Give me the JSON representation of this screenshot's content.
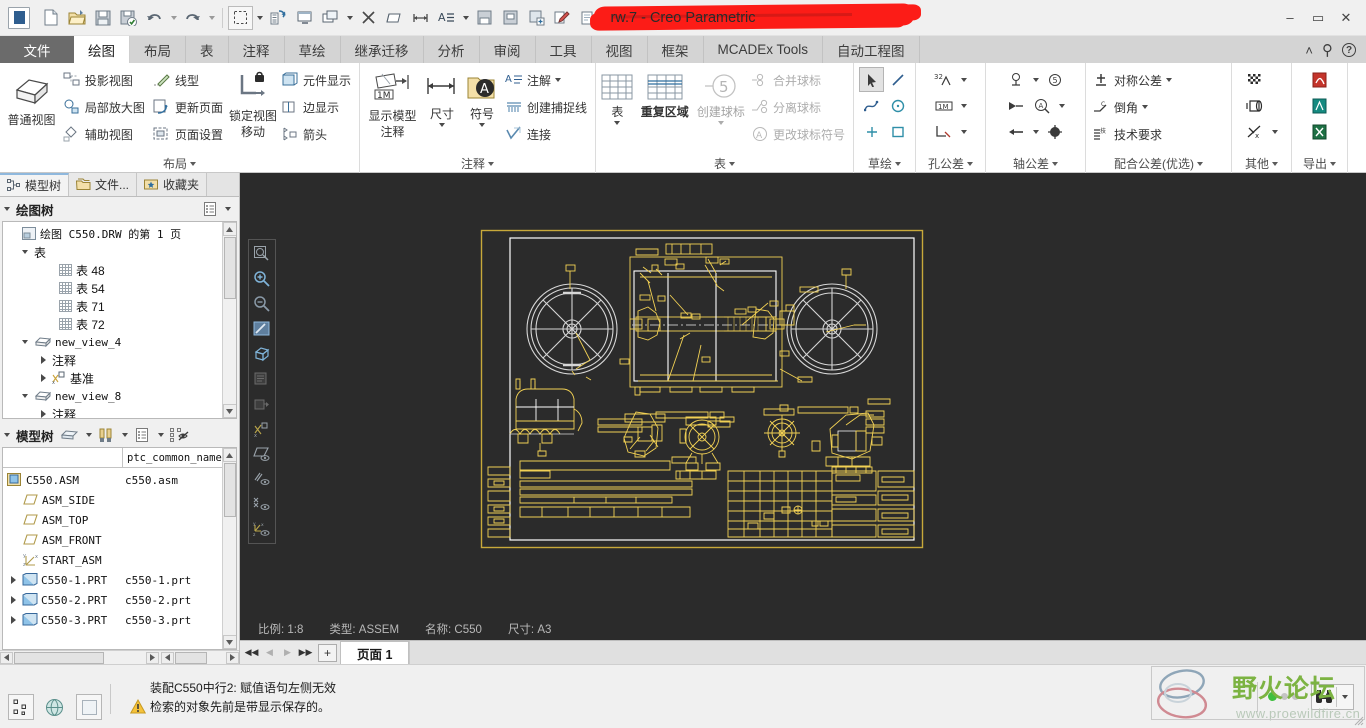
{
  "window": {
    "title": "rw.7 - Creo Parametric",
    "redacted": true,
    "minimize": "–",
    "maximize": "▭",
    "close": "✕"
  },
  "quick_access": [
    {
      "name": "new-file-icon",
      "label": "新建"
    },
    {
      "name": "open-file-icon",
      "label": "打开"
    },
    {
      "name": "save-icon",
      "label": "保存"
    },
    {
      "name": "save-as-icon",
      "label": "另存为"
    },
    {
      "name": "undo-icon",
      "label": "撤消"
    },
    {
      "name": "redo-icon",
      "label": "重做"
    },
    {
      "name": "select-region-icon",
      "label": "选择"
    },
    {
      "name": "regenerate-icon",
      "label": "重新生成"
    },
    {
      "name": "display-style-icon",
      "label": "显示样式"
    },
    {
      "name": "window-icon",
      "label": "窗口"
    },
    {
      "name": "close-window-icon",
      "label": "关闭"
    },
    {
      "name": "erase-icon",
      "label": "拭除"
    },
    {
      "name": "dimension-icon",
      "label": "尺寸"
    },
    {
      "name": "text-style-icon",
      "label": "文本样式"
    },
    {
      "name": "save-sheet-icon",
      "label": "保存页面"
    },
    {
      "name": "sheet-setup-icon",
      "label": "页面设置"
    },
    {
      "name": "sheet-add-icon",
      "label": "添加页面"
    },
    {
      "name": "annotate-icon",
      "label": "注释"
    },
    {
      "name": "export-icon",
      "label": "导出"
    }
  ],
  "ribbon_tabs": [
    {
      "label": "文件",
      "active": false,
      "is_file": true
    },
    {
      "label": "绘图",
      "active": true
    },
    {
      "label": "布局",
      "active": false
    },
    {
      "label": "表",
      "active": false
    },
    {
      "label": "注释",
      "active": false
    },
    {
      "label": "草绘",
      "active": false
    },
    {
      "label": "继承迁移",
      "active": false
    },
    {
      "label": "分析",
      "active": false
    },
    {
      "label": "审阅",
      "active": false
    },
    {
      "label": "工具",
      "active": false
    },
    {
      "label": "视图",
      "active": false
    },
    {
      "label": "框架",
      "active": false
    },
    {
      "label": "MCADEx Tools",
      "active": false
    },
    {
      "label": "自动工程图",
      "active": false
    }
  ],
  "tab_right_icons": [
    {
      "name": "collapse-ribbon-icon",
      "glyph": "˄"
    },
    {
      "name": "search-icon",
      "glyph": "⚲"
    },
    {
      "name": "help-icon",
      "glyph": "?"
    }
  ],
  "ribbon_groups": [
    {
      "title": "布局",
      "big_button": {
        "label": "普通视图",
        "icon": "general-view-icon"
      },
      "columns": [
        {
          "items": [
            {
              "label": "投影视图",
              "icon": "projection-view-icon",
              "disabled": false
            },
            {
              "label": "局部放大图",
              "icon": "detailed-view-icon",
              "disabled": false
            },
            {
              "label": "辅助视图",
              "icon": "auxiliary-view-icon",
              "disabled": false
            }
          ]
        },
        {
          "items": [
            {
              "label": "线型",
              "icon": "line-style-icon",
              "disabled": false
            },
            {
              "label": "更新页面",
              "icon": "update-sheet-icon",
              "disabled": false
            },
            {
              "label": "页面设置",
              "icon": "sheet-setup-icon",
              "disabled": false
            }
          ]
        }
      ],
      "stack_button": {
        "label1": "锁定视图",
        "label2": "移动",
        "icon": "lock-view-movement-icon"
      },
      "columns2": [
        {
          "items": [
            {
              "label": "元件显示",
              "icon": "component-display-icon",
              "disabled": false
            },
            {
              "label": "边显示",
              "icon": "edge-display-icon",
              "disabled": false
            },
            {
              "label": "箭头",
              "icon": "arrows-icon",
              "disabled": false
            }
          ]
        }
      ]
    },
    {
      "title": "注释",
      "big_buttons": [
        {
          "label1": "显示模型",
          "label2": "注释",
          "icon": "show-model-annotations-icon",
          "caret": false
        },
        {
          "label1": "尺寸",
          "label2": "",
          "icon": "dimension-icon",
          "caret": true
        },
        {
          "label1": "符号",
          "label2": "",
          "icon": "symbol-icon",
          "caret": true
        }
      ],
      "columns": [
        {
          "items": [
            {
              "label": "注解",
              "icon": "note-icon",
              "caret": true
            },
            {
              "label": "创建捕捉线",
              "icon": "snap-line-icon"
            },
            {
              "label": "连接",
              "icon": "connect-icon"
            }
          ]
        }
      ]
    },
    {
      "title": "表",
      "big_buttons": [
        {
          "label1": "表",
          "label2": "",
          "icon": "table-icon",
          "caret": true
        },
        {
          "label1": "重复区域",
          "label2": "",
          "icon": "repeat-region-icon",
          "caret": false
        },
        {
          "label1": "创建球标",
          "label2": "",
          "icon": "create-balloons-icon",
          "caret": true,
          "disabled": true
        }
      ],
      "columns": [
        {
          "items": [
            {
              "label": "合并球标",
              "icon": "merge-balloons-icon",
              "disabled": true
            },
            {
              "label": "分离球标",
              "icon": "split-balloons-icon",
              "disabled": true
            },
            {
              "label": "更改球标符号",
              "icon": "change-balloon-symbol-icon",
              "disabled": true
            }
          ]
        }
      ]
    },
    {
      "title": "草绘",
      "icon_grid": [
        [
          {
            "name": "select-arrow-icon",
            "selected": true
          },
          {
            "name": "line-icon"
          }
        ],
        [
          {
            "name": "spline-icon"
          },
          {
            "name": "circle-icon"
          }
        ],
        [
          {
            "name": "point-icon"
          },
          {
            "name": "rectangle-icon"
          }
        ]
      ]
    },
    {
      "title": "孔公差",
      "icon_grid": [
        [
          {
            "name": "surface-finish-32-icon",
            "caret": true
          }
        ],
        [
          {
            "name": "datum-1m-icon",
            "caret": true
          }
        ],
        [
          {
            "name": "hole-tolerance-icon",
            "caret": true
          }
        ]
      ]
    },
    {
      "title": "轴公差",
      "icon_grid": [
        [
          {
            "name": "datum-feature-icon",
            "caret": true
          },
          {
            "name": "balloon-5-icon"
          }
        ],
        [
          {
            "name": "arrow-leader-icon"
          },
          {
            "name": "magnify-balloon-icon",
            "caret": true
          }
        ],
        [
          {
            "name": "left-arrow-icon",
            "caret": true
          },
          {
            "name": "center-mark-icon"
          }
        ]
      ]
    },
    {
      "title": "配合公差(优选)",
      "columns": [
        {
          "items": [
            {
              "label": "对称公差",
              "icon": "symmetric-tolerance-icon",
              "caret": true
            },
            {
              "label": "倒角",
              "icon": "chamfer-icon",
              "caret": true
            },
            {
              "label": "技术要求",
              "icon": "technical-requirements-icon"
            }
          ]
        }
      ]
    },
    {
      "title": "其他",
      "icon_grid": [
        [
          {
            "name": "hatch-pattern-icon"
          }
        ],
        [
          {
            "name": "cylinder-icon"
          }
        ],
        [
          {
            "name": "cross-lines-icon",
            "caret": true
          }
        ]
      ]
    },
    {
      "title": "导出",
      "icon_grid": [
        [
          {
            "name": "export-pdf-icon"
          }
        ],
        [
          {
            "name": "export-dwg-icon"
          }
        ],
        [
          {
            "name": "export-excel-icon"
          }
        ]
      ]
    }
  ],
  "left_panel": {
    "nav_tabs": [
      {
        "label": "模型树",
        "icon": "model-tree-icon",
        "active": true
      },
      {
        "label": "文件...",
        "icon": "folder-browser-icon",
        "active": false
      },
      {
        "label": "收藏夹",
        "icon": "favorites-icon",
        "active": false
      }
    ],
    "drawing_tree": {
      "title": "绘图树",
      "settings_icon": "tree-settings-icon",
      "nodes": [
        {
          "indent": 0,
          "twisty": "",
          "icon": "sheet-icon",
          "label": "绘图 C550.DRW 的第 1 页",
          "mono": true
        },
        {
          "indent": 1,
          "twisty": "down",
          "icon": "",
          "label": "表",
          "mono": false
        },
        {
          "indent": 3,
          "twisty": "",
          "icon": "table-icon",
          "label": "表 48",
          "mono": false
        },
        {
          "indent": 3,
          "twisty": "",
          "icon": "table-icon",
          "label": "表 54",
          "mono": false
        },
        {
          "indent": 3,
          "twisty": "",
          "icon": "table-icon",
          "label": "表 71",
          "mono": false
        },
        {
          "indent": 3,
          "twisty": "",
          "icon": "table-icon",
          "label": "表 72",
          "mono": false
        },
        {
          "indent": 1,
          "twisty": "down",
          "icon": "view-icon",
          "label": "new_view_4",
          "mono": true
        },
        {
          "indent": 2,
          "twisty": "right",
          "icon": "",
          "label": "注释",
          "mono": false
        },
        {
          "indent": 2,
          "twisty": "right",
          "icon": "datum-icon",
          "label": "基准",
          "mono": false
        },
        {
          "indent": 1,
          "twisty": "down",
          "icon": "view-icon",
          "label": "new_view_8",
          "mono": true
        },
        {
          "indent": 2,
          "twisty": "right",
          "icon": "",
          "label": "注释",
          "mono": false
        }
      ]
    },
    "model_tree": {
      "title": "模型树",
      "toolbar_icons": [
        {
          "name": "model-filter-icon",
          "caret": true
        },
        {
          "name": "settings-tools-icon",
          "caret": true
        },
        {
          "name": "tree-columns-icon",
          "caret": true
        },
        {
          "name": "tree-display-icon",
          "caret": false
        }
      ],
      "columns": [
        "",
        "ptc_common_name"
      ],
      "rows": [
        {
          "indent": 0,
          "twisty": "",
          "icon": "assembly-icon",
          "name": "C550.ASM",
          "common_name": "c550.asm"
        },
        {
          "indent": 1,
          "twisty": "",
          "icon": "plane-icon",
          "name": "ASM_SIDE",
          "common_name": ""
        },
        {
          "indent": 1,
          "twisty": "",
          "icon": "plane-icon",
          "name": "ASM_TOP",
          "common_name": ""
        },
        {
          "indent": 1,
          "twisty": "",
          "icon": "plane-icon",
          "name": "ASM_FRONT",
          "common_name": ""
        },
        {
          "indent": 1,
          "twisty": "",
          "icon": "csys-icon",
          "name": "START_ASM",
          "common_name": ""
        },
        {
          "indent": 0,
          "twisty": "right",
          "icon": "part-icon",
          "name": "C550-1.PRT",
          "common_name": "c550-1.prt"
        },
        {
          "indent": 0,
          "twisty": "right",
          "icon": "part-icon",
          "name": "C550-2.PRT",
          "common_name": "c550-2.prt"
        },
        {
          "indent": 0,
          "twisty": "right",
          "icon": "part-icon",
          "name": "C550-3.PRT",
          "common_name": "c550-3.prt"
        }
      ]
    }
  },
  "canvas": {
    "background_color": "#2b2b2b",
    "sheet_border_color": "#c8a93a",
    "geometry_color": "#f2d154",
    "wheel_color": "#d6d6d6",
    "view_tools": [
      {
        "name": "refit-icon"
      },
      {
        "name": "zoom-in-icon"
      },
      {
        "name": "zoom-out-icon"
      },
      {
        "name": "repaint-icon"
      },
      {
        "name": "display-style-icon"
      },
      {
        "name": "saved-views-icon"
      },
      {
        "name": "view-manager-icon"
      },
      {
        "name": "datum-display-icon"
      },
      {
        "name": "plane-display-icon"
      },
      {
        "name": "axis-display-icon"
      },
      {
        "name": "point-display-icon"
      },
      {
        "name": "csys-display-icon"
      }
    ]
  },
  "status_line": {
    "items": [
      {
        "key": "比例",
        "value": "1:8",
        "text": "比例: 1:8"
      },
      {
        "key": "类型",
        "value": "ASSEM",
        "text": "类型: ASSEM"
      },
      {
        "key": "名称",
        "value": "C550",
        "text": "名称: C550"
      },
      {
        "key": "尺寸",
        "value": "A3",
        "text": "尺寸: A3"
      }
    ]
  },
  "page_tabs": {
    "nav": [
      {
        "name": "first-page-button",
        "glyph": "◀◀",
        "disabled": false
      },
      {
        "name": "prev-page-button",
        "glyph": "◀",
        "disabled": true
      },
      {
        "name": "next-page-button",
        "glyph": "▶",
        "disabled": true
      },
      {
        "name": "last-page-button",
        "glyph": "▶▶",
        "disabled": false
      }
    ],
    "add_label": "+",
    "tabs": [
      {
        "label": "页面 1",
        "active": true
      }
    ]
  },
  "bottom": {
    "icons": [
      {
        "name": "selection-filter-icon"
      },
      {
        "name": "web-browser-icon"
      },
      {
        "name": "blank-panel-icon"
      }
    ],
    "messages": [
      {
        "icon": "",
        "text": "装配C550中行2: 赋值语句左侧无效"
      },
      {
        "icon": "warning-icon",
        "text": "检索的对象先前是带显示保存的。"
      }
    ],
    "leds": [
      {
        "name": "led-green",
        "color": "#3fbf3f"
      },
      {
        "name": "led-gray-1",
        "color": "#c4c4c4"
      },
      {
        "name": "led-gray-2",
        "color": "#c4c4c4"
      }
    ],
    "search_icon": "binoculars-icon",
    "watermark": {
      "text": "野火论坛",
      "url": "www.proewildfire.cn",
      "text_color": "#7cb342"
    }
  }
}
